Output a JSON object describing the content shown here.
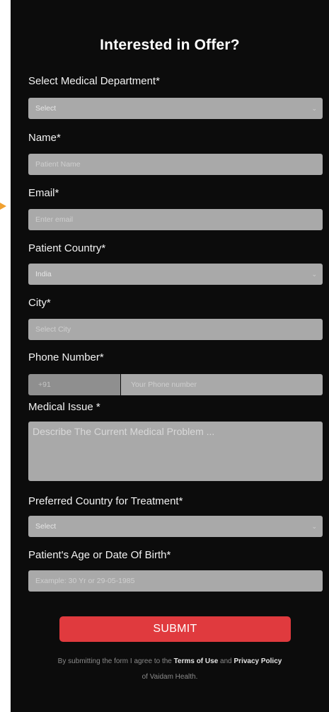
{
  "form": {
    "title": "Interested in Offer?",
    "department": {
      "label": "Select Medical Department*",
      "value": "Select"
    },
    "name": {
      "label": "Name*",
      "placeholder": "Patient Name"
    },
    "email": {
      "label": "Email*",
      "placeholder": "Enter email"
    },
    "country": {
      "label": "Patient Country*",
      "value": "India"
    },
    "city": {
      "label": "City*",
      "placeholder": "Select City"
    },
    "phone": {
      "label": "Phone Number*",
      "code": "+91",
      "placeholder": "Your Phone number"
    },
    "issue": {
      "label": "Medical Issue *",
      "placeholder": "Describe The Current Medical Problem ..."
    },
    "treatment_country": {
      "label": "Preferred Country for Treatment*",
      "value": "Select"
    },
    "age": {
      "label": "Patient's Age or Date Of Birth*",
      "placeholder": "Example: 30 Yr or 29-05-1985"
    },
    "submit_label": "SUBMIT",
    "terms": {
      "prefix": "By submitting the form I agree to the",
      "terms_link": "Terms of Use",
      "and": "and",
      "privacy_link": "Privacy Policy",
      "suffix": "of Vaidam Health."
    }
  },
  "colors": {
    "panel_bg": "#0c0c0c",
    "field_bg": "#a9a9a9",
    "submit_bg": "#e03a3e",
    "arrow": "#f0a030"
  },
  "icons": {
    "dropdown": "chevron-down-icon",
    "pointer": "arrow-right-icon"
  }
}
